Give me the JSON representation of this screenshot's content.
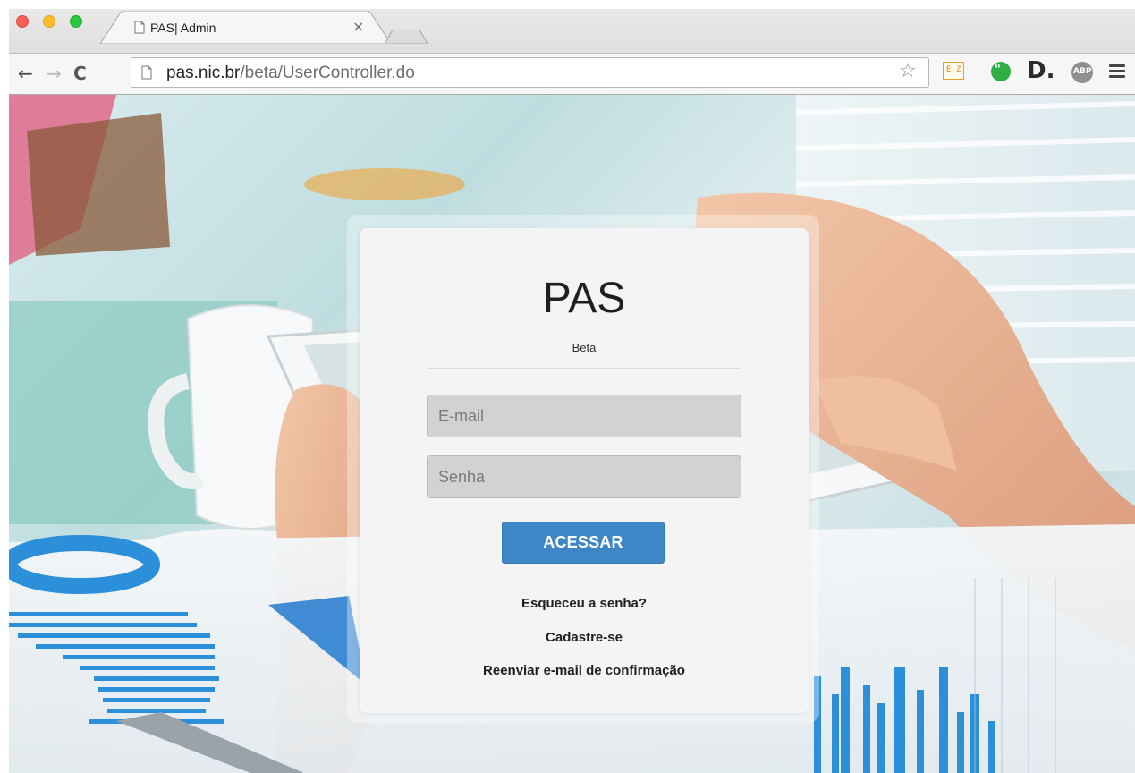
{
  "browser": {
    "tab": {
      "title": "PAS| Admin",
      "close_glyph": "×"
    },
    "nav": {
      "back_glyph": "←",
      "forward_glyph": "→",
      "reload_glyph": "C"
    },
    "url": {
      "host": "pas.nic.br",
      "path": "/beta/UserController.do"
    },
    "bookmark_glyph": "☆",
    "extensions": [
      {
        "name": "ez-translate-icon",
        "label": "E Z"
      },
      {
        "name": "hangouts-icon",
        "label": "99"
      },
      {
        "name": "d-extension-icon",
        "label": "D."
      },
      {
        "name": "adblock-plus-icon",
        "label": "ABP"
      }
    ],
    "menu_icon": "hamburger-menu-icon"
  },
  "login": {
    "title": "PAS",
    "subtitle": "Beta",
    "email_placeholder": "E-mail",
    "password_placeholder": "Senha",
    "submit_label": "ACESSAR",
    "links": {
      "forgot": "Esqueceu a senha?",
      "signup": "Cadastre-se",
      "resend": "Reenviar e-mail de confirmação"
    }
  },
  "colors": {
    "accent": "#3e86c6",
    "card_background": "#f4f4f4",
    "input_background": "#d2d2d2"
  }
}
